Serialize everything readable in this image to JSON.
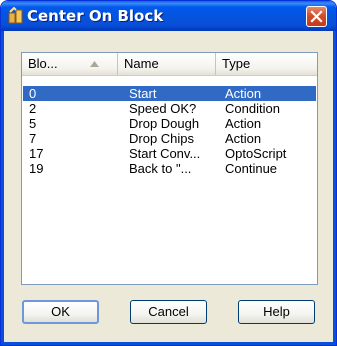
{
  "window": {
    "title": "Center On Block"
  },
  "list": {
    "columns": [
      "Blo...",
      "Name",
      "Type"
    ],
    "rows": [
      {
        "block": "0",
        "name": "Start",
        "type": "Action",
        "selected": true
      },
      {
        "block": "2",
        "name": "Speed OK?",
        "type": "Condition",
        "selected": false
      },
      {
        "block": "5",
        "name": "Drop Dough",
        "type": "Action",
        "selected": false
      },
      {
        "block": "7",
        "name": "Drop Chips",
        "type": "Action",
        "selected": false
      },
      {
        "block": "17",
        "name": "Start Conv...",
        "type": "OptoScript",
        "selected": false
      },
      {
        "block": "19",
        "name": "Back to  \"...",
        "type": "Continue",
        "selected": false
      }
    ]
  },
  "buttons": {
    "ok": "OK",
    "cancel": "Cancel",
    "help": "Help"
  },
  "colors": {
    "titlebar": "#0453dc",
    "selection": "#316ac5",
    "dialog_bg": "#ece9d8"
  }
}
